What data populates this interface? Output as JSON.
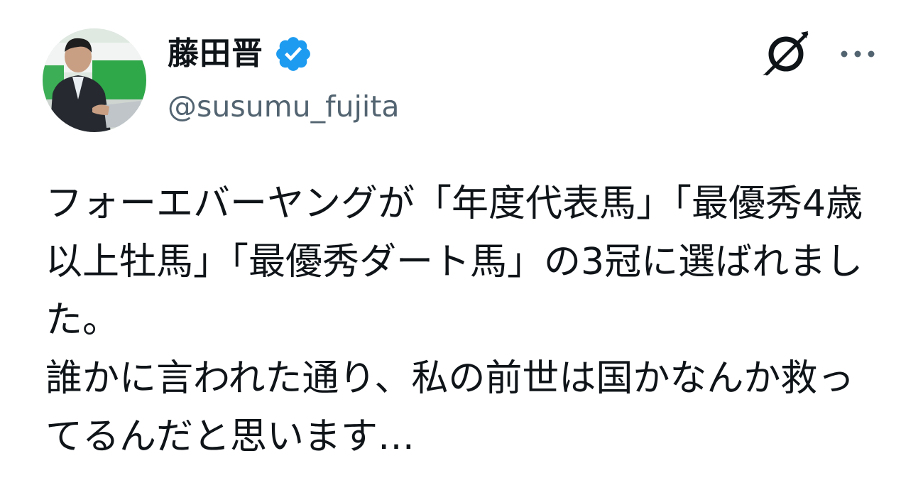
{
  "author": {
    "display_name": "藤田晋",
    "handle": "@susumu_fujita",
    "verified": true,
    "avatar_icon": "profile-photo"
  },
  "actions": {
    "grok_icon": "grok-icon",
    "more_icon": "more-icon"
  },
  "tweet": {
    "text": "フォーエバーヤングが「年度代表馬」「最優秀4歳以上牡馬」「最優秀ダート馬」の3冠に選ばれました。\n誰かに言われた通り、私の前世は国かなんか救ってるんだと思います…"
  },
  "colors": {
    "text": "#0f1419",
    "secondary": "#536471",
    "verified_blue": "#1d9bf0"
  }
}
